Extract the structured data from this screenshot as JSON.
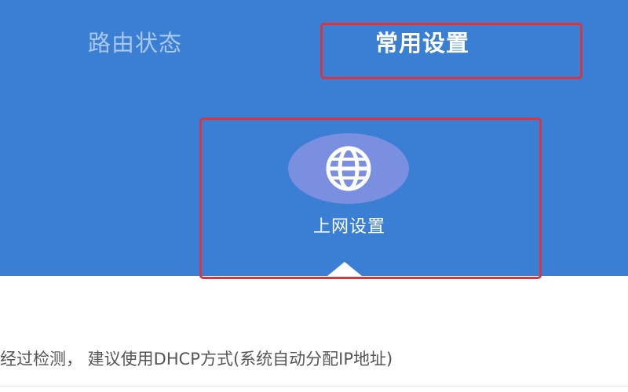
{
  "tabs": {
    "status_label": "路由状态",
    "settings_label": "常用设置"
  },
  "quick_setting": {
    "label": "上网设置",
    "icon": "globe-icon"
  },
  "detection_message": "经过检测， 建议使用DHCP方式(系统自动分配IP地址)",
  "colors": {
    "header_bg": "#3a7fd4",
    "icon_circle": "#7b8fe0",
    "highlight_border": "#d7353f",
    "inactive_tab": "#a9c8ee"
  }
}
